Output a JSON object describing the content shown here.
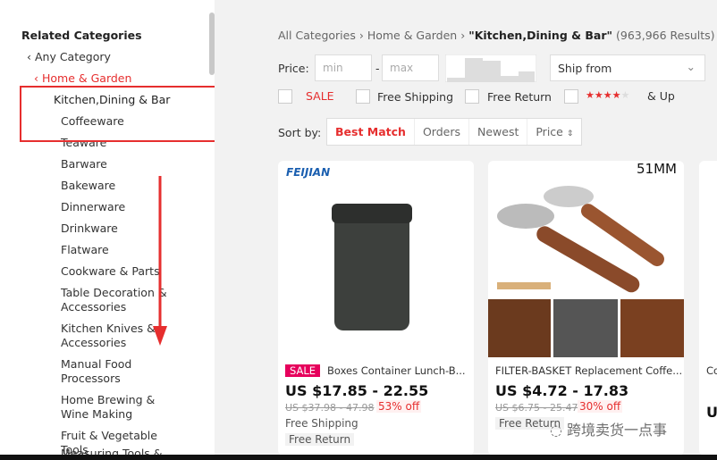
{
  "sidebar": {
    "title": "Related Categories",
    "any": "Any Category",
    "parent": "Home & Garden",
    "current": "Kitchen,Dining & Bar",
    "items": [
      "Coffeeware",
      "Teaware",
      "Barware",
      "Bakeware",
      "Dinnerware",
      "Drinkware",
      "Flatware",
      "Cookware & Parts",
      "Table Decoration & Accessories",
      "Kitchen Knives & Accessories",
      "Manual Food Processors",
      "Home Brewing & Wine Making",
      "Fruit & Vegetable Tools",
      "Measuring Tools &"
    ]
  },
  "breadcrumb": {
    "a": "All Categories",
    "b": "Home & Garden",
    "c": "\"Kitchen,Dining & Bar\"",
    "count": "(963,966 Results)"
  },
  "filters": {
    "price_label": "Price:",
    "min": "min",
    "max": "max",
    "dash": "-",
    "ship_from": "Ship from",
    "sale": "SALE",
    "free_shipping": "Free Shipping",
    "free_return": "Free Return",
    "stars": "★★★★",
    "star_empty": "★",
    "up": "& Up"
  },
  "sort": {
    "label": "Sort by:",
    "options": [
      "Best Match",
      "Orders",
      "Newest",
      "Price"
    ]
  },
  "products": [
    {
      "brand": "FEIJIAN",
      "badge": "SALE",
      "title": "Boxes Container Lunch-B...",
      "price": "US $17.85 - 22.55",
      "old": "US $37.98 - 47.98",
      "off": "53% off",
      "tags": [
        "Free Shipping",
        "Free Return"
      ]
    },
    {
      "corner": "51MM",
      "title": "FILTER-BASKET Replacement Coffe...",
      "price": "US $4.72 - 17.83",
      "old": "US $6.75 - 25.47",
      "off": "30% off",
      "tags": [
        "Free Return"
      ]
    },
    {
      "title": "Co",
      "price": "U"
    }
  ],
  "watermark": "跨境卖货一点事",
  "colors": {
    "accent": "#e62e2e",
    "highlight_box": "#e62e2e"
  }
}
